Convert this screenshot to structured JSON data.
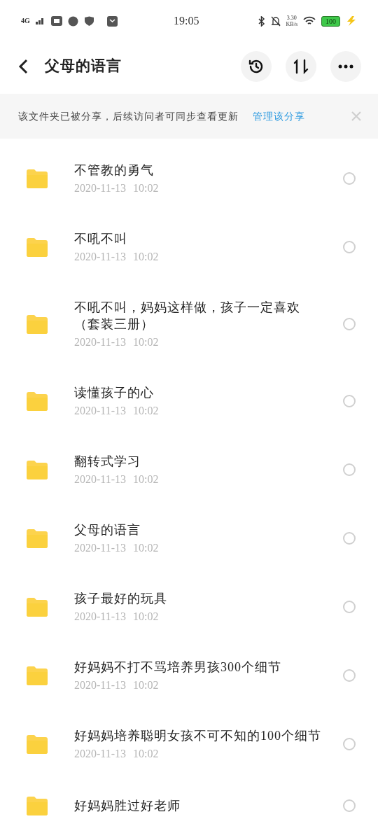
{
  "status_bar": {
    "network": "4G",
    "time": "19:05",
    "speed": "3.30",
    "speed_unit": "KB/s",
    "battery": "100"
  },
  "header": {
    "title": "父母的语言"
  },
  "share_banner": {
    "text": "该文件夹已被分享，后续访问者可同步查看更新",
    "link": "管理该分享"
  },
  "files": [
    {
      "name": "不管教的勇气",
      "date": "2020-11-13",
      "time": "10:02",
      "selected": false
    },
    {
      "name": "不吼不叫",
      "date": "2020-11-13",
      "time": "10:02",
      "selected": false
    },
    {
      "name": "不吼不叫，妈妈这样做，孩子一定喜欢（套装三册）",
      "date": "2020-11-13",
      "time": "10:02",
      "selected": false
    },
    {
      "name": "读懂孩子的心",
      "date": "2020-11-13",
      "time": "10:02",
      "selected": false
    },
    {
      "name": "翻转式学习",
      "date": "2020-11-13",
      "time": "10:02",
      "selected": false
    },
    {
      "name": "父母的语言",
      "date": "2020-11-13",
      "time": "10:02",
      "selected": false
    },
    {
      "name": "孩子最好的玩具",
      "date": "2020-11-13",
      "time": "10:02",
      "selected": false
    },
    {
      "name": "好妈妈不打不骂培养男孩300个细节",
      "date": "2020-11-13",
      "time": "10:02",
      "selected": false
    },
    {
      "name": "好妈妈培养聪明女孩不可不知的100个细节",
      "date": "2020-11-13",
      "time": "10:02",
      "selected": false
    },
    {
      "name": "好妈妈胜过好老师",
      "selected": false
    }
  ]
}
